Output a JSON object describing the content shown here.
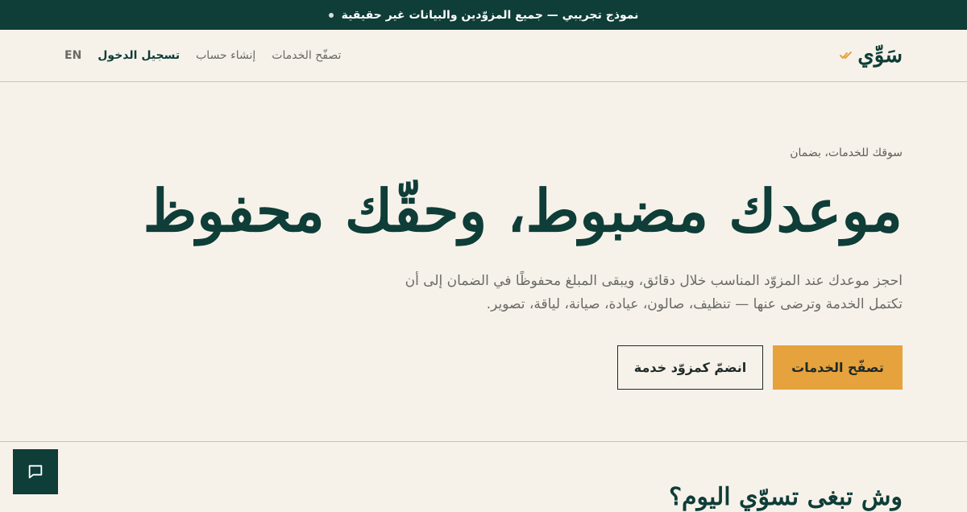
{
  "announcement": {
    "text": "نموذج تجريبي — جميع المزوّدين والبيانات غير حقيقية",
    "icon": "dot-icon"
  },
  "nav": {
    "brand": "سَوِّي",
    "brand_icon": "double-check-icon",
    "links": {
      "browse": "تصفّح الخدمات",
      "signup": "إنشاء حساب",
      "login": "تسجيل الدخول",
      "lang": "EN"
    }
  },
  "hero": {
    "eyebrow": "سوقك للخدمات، بضمان",
    "title": "موعدك مضبوط، وحقّك محفوظ",
    "description": "احجز موعدك عند المزوّد المناسب خلال دقائق، ويبقى المبلغ محفوظًا في الضمان إلى أن تكتمل الخدمة وترضى عنها — تنظيف، صالون، عيادة، صيانة، لياقة، تصوير.",
    "primary_cta": "تصفّح الخدمات",
    "secondary_cta": "انضمّ كمزوّد خدمة"
  },
  "section": {
    "title": "وش تبغى تسوّي اليوم؟"
  },
  "chat": {
    "icon": "chat-bubble-icon"
  },
  "colors": {
    "dark_green": "#0f3d38",
    "accent": "#e6a23c",
    "background": "#f6f2ea"
  }
}
